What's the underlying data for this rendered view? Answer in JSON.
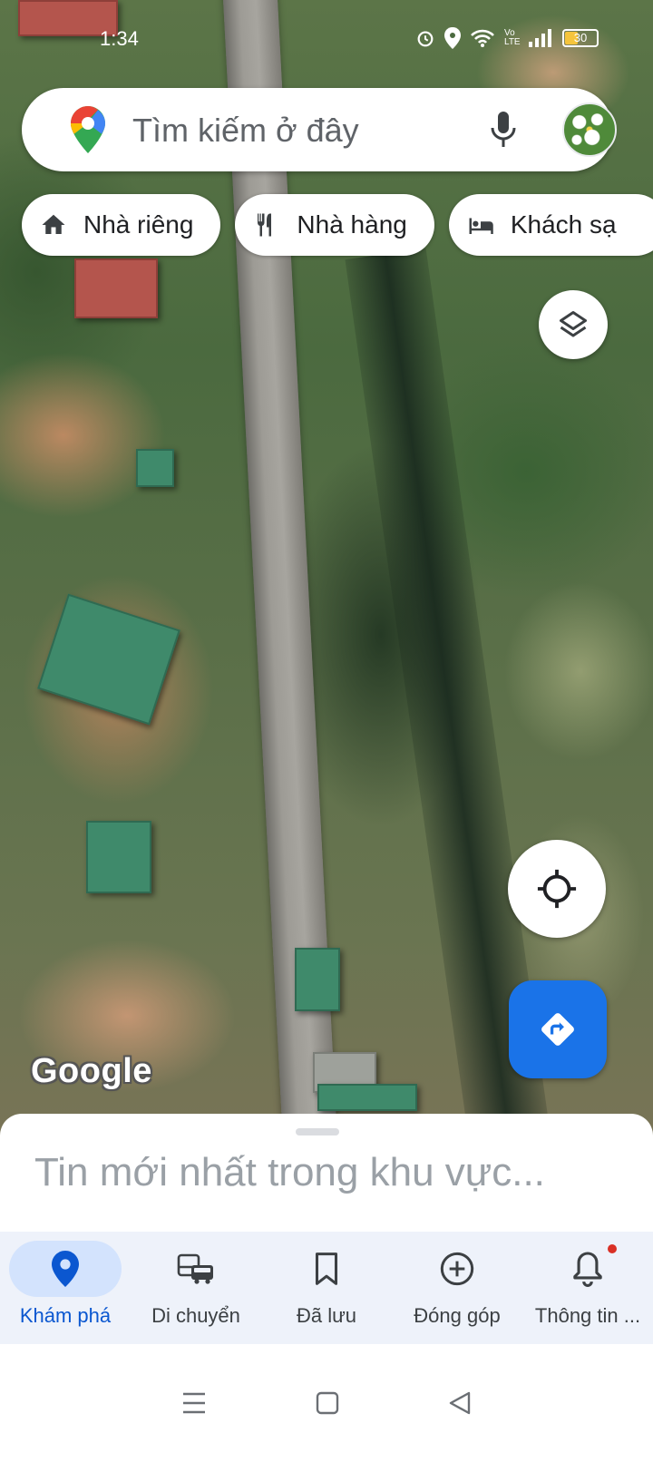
{
  "status_bar": {
    "time": "1:34",
    "signal_label": "Vo LTE",
    "battery": "30"
  },
  "search": {
    "placeholder": "Tìm kiếm ở đây"
  },
  "chips": [
    {
      "label": "Nhà riêng",
      "icon": "home-icon"
    },
    {
      "label": "Nhà hàng",
      "icon": "restaurant-icon"
    },
    {
      "label": "Khách sạ",
      "icon": "hotel-icon"
    }
  ],
  "map": {
    "attribution": "Google"
  },
  "sheet": {
    "title": "Tin mới nhất trong khu vực..."
  },
  "bottom_nav": [
    {
      "label": "Khám phá",
      "icon": "location-pin-icon",
      "active": true
    },
    {
      "label": "Di chuyển",
      "icon": "commute-icon",
      "active": false
    },
    {
      "label": "Đã lưu",
      "icon": "bookmark-icon",
      "active": false
    },
    {
      "label": "Đóng góp",
      "icon": "add-circle-icon",
      "active": false
    },
    {
      "label": "Thông tin ...",
      "icon": "bell-icon",
      "active": false
    }
  ],
  "colors": {
    "accent": "#1a73e8",
    "active_nav": "#0b57d0",
    "active_pill": "#d3e3fd",
    "notification_dot": "#d93025"
  }
}
